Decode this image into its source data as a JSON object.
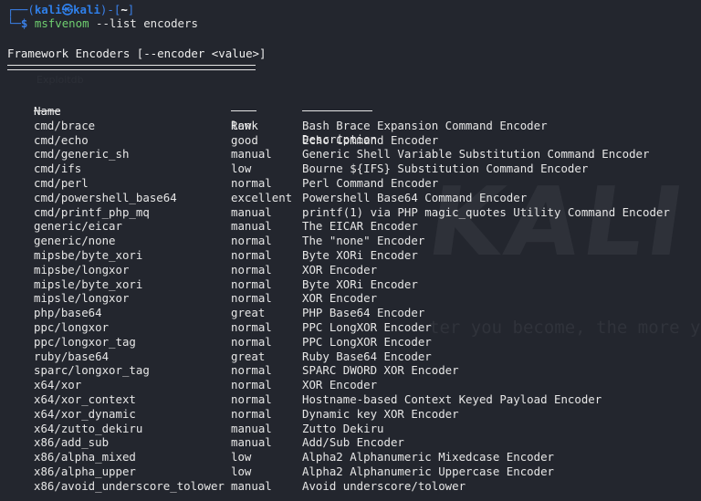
{
  "prompt": {
    "corner_top": "┌──(",
    "user": "kali",
    "at": "㉿",
    "host": "kali",
    "mid": ")-[",
    "dir": "~",
    "end": "]",
    "corner_bottom": "└─",
    "dollar": "$",
    "command": "msfvenom",
    "args": " --list encoders"
  },
  "section": {
    "title": "Framework Encoders [--encoder <value>]"
  },
  "table": {
    "columns": {
      "name": "Name",
      "rank": "Rank",
      "description": "Description"
    },
    "rows": [
      {
        "name": "cmd/brace",
        "rank": "low",
        "description": "Bash Brace Expansion Command Encoder"
      },
      {
        "name": "cmd/echo",
        "rank": "good",
        "description": "Echo Command Encoder"
      },
      {
        "name": "cmd/generic_sh",
        "rank": "manual",
        "description": "Generic Shell Variable Substitution Command Encoder"
      },
      {
        "name": "cmd/ifs",
        "rank": "low",
        "description": "Bourne ${IFS} Substitution Command Encoder"
      },
      {
        "name": "cmd/perl",
        "rank": "normal",
        "description": "Perl Command Encoder"
      },
      {
        "name": "cmd/powershell_base64",
        "rank": "excellent",
        "description": "Powershell Base64 Command Encoder"
      },
      {
        "name": "cmd/printf_php_mq",
        "rank": "manual",
        "description": "printf(1) via PHP magic_quotes Utility Command Encoder"
      },
      {
        "name": "generic/eicar",
        "rank": "manual",
        "description": "The EICAR Encoder"
      },
      {
        "name": "generic/none",
        "rank": "normal",
        "description": "The \"none\" Encoder"
      },
      {
        "name": "mipsbe/byte_xori",
        "rank": "normal",
        "description": "Byte XORi Encoder"
      },
      {
        "name": "mipsbe/longxor",
        "rank": "normal",
        "description": "XOR Encoder"
      },
      {
        "name": "mipsle/byte_xori",
        "rank": "normal",
        "description": "Byte XORi Encoder"
      },
      {
        "name": "mipsle/longxor",
        "rank": "normal",
        "description": "XOR Encoder"
      },
      {
        "name": "php/base64",
        "rank": "great",
        "description": "PHP Base64 Encoder"
      },
      {
        "name": "ppc/longxor",
        "rank": "normal",
        "description": "PPC LongXOR Encoder"
      },
      {
        "name": "ppc/longxor_tag",
        "rank": "normal",
        "description": "PPC LongXOR Encoder"
      },
      {
        "name": "ruby/base64",
        "rank": "great",
        "description": "Ruby Base64 Encoder"
      },
      {
        "name": "sparc/longxor_tag",
        "rank": "normal",
        "description": "SPARC DWORD XOR Encoder"
      },
      {
        "name": "x64/xor",
        "rank": "normal",
        "description": "XOR Encoder"
      },
      {
        "name": "x64/xor_context",
        "rank": "normal",
        "description": "Hostname-based Context Keyed Payload Encoder"
      },
      {
        "name": "x64/xor_dynamic",
        "rank": "normal",
        "description": "Dynamic key XOR Encoder"
      },
      {
        "name": "x64/zutto_dekiru",
        "rank": "manual",
        "description": "Zutto Dekiru"
      },
      {
        "name": "x86/add_sub",
        "rank": "manual",
        "description": "Add/Sub Encoder"
      },
      {
        "name": "x86/alpha_mixed",
        "rank": "low",
        "description": "Alpha2 Alphanumeric Mixedcase Encoder"
      },
      {
        "name": "x86/alpha_upper",
        "rank": "low",
        "description": "Alpha2 Alphanumeric Uppercase Encoder"
      },
      {
        "name": "x86/avoid_underscore_tolower",
        "rank": "manual",
        "description": "Avoid underscore/tolower"
      }
    ]
  },
  "watermark": {
    "logo_text": "KALI LI",
    "tagline": "ter you become, the more y",
    "small": "Exploitdb"
  },
  "colors": {
    "background": "#23262e",
    "prompt_blue": "#3a80e8",
    "command_green": "#6fce6f",
    "text": "#e6e6e6"
  }
}
